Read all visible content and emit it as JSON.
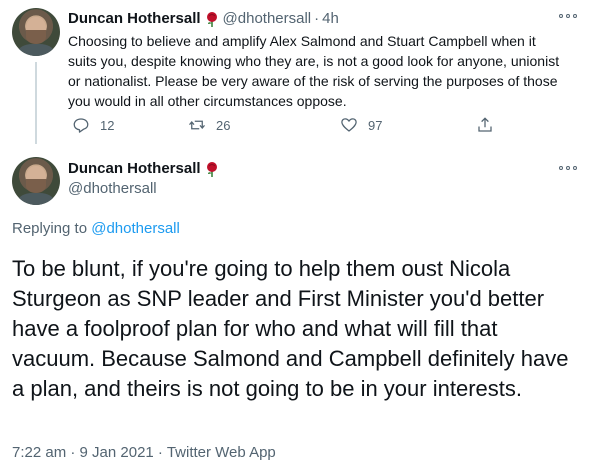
{
  "parent_tweet": {
    "display_name": "Duncan Hothersall",
    "handle": "@dhothersall",
    "separator": "·",
    "time_ago": "4h",
    "text": "Choosing to believe and amplify Alex Salmond and Stuart Campbell when it suits you, despite knowing who they are, is not a good look for anyone, unionist or nationalist. Please be very aware of the risk of serving the purposes of those you would in all other circumstances oppose.",
    "reply_count": "12",
    "retweet_count": "26",
    "like_count": "97",
    "icons": [
      "rose-icon",
      "more-icon",
      "reply-icon",
      "retweet-icon",
      "like-icon",
      "share-icon"
    ]
  },
  "main_tweet": {
    "display_name": "Duncan Hothersall",
    "handle": "@dhothersall",
    "replying_prefix": "Replying to ",
    "replying_handle": "@dhothersall",
    "text": "To be blunt, if you're going to help them oust Nicola Sturgeon as SNP leader and First Minister you'd better have a foolproof plan for who and what will fill that vacuum. Because Salmond and Campbell definitely have a plan, and theirs is not going to be in your interests.",
    "timestamp": "7:22 am · 9 Jan 2021 · Twitter Web App",
    "icons": [
      "rose-icon",
      "more-icon"
    ]
  },
  "colors": {
    "text": "#0f1419",
    "secondary": "#536471",
    "link": "#1d9bf0",
    "rose": "#c0102a",
    "thread_line": "#cfd9de"
  }
}
